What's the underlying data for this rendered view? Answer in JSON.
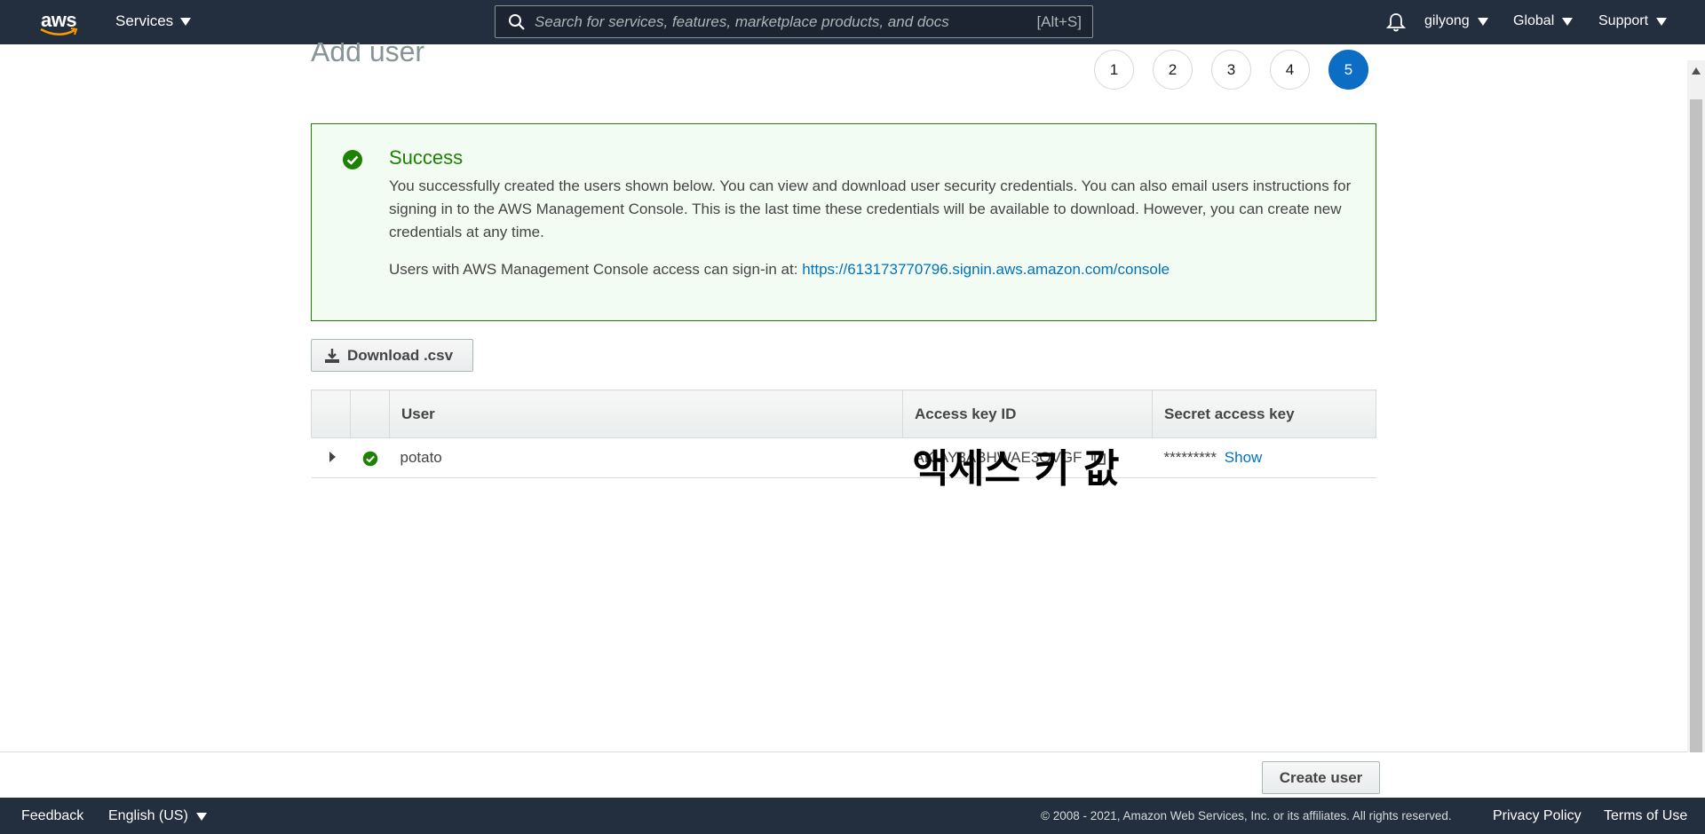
{
  "nav": {
    "logo_text": "aws",
    "services_label": "Services",
    "search_placeholder": "Search for services, features, marketplace products, and docs",
    "search_hint": "[Alt+S]",
    "user_label": "gilyong",
    "region_label": "Global",
    "support_label": "Support"
  },
  "page": {
    "title": "Add user",
    "steps": [
      "1",
      "2",
      "3",
      "4",
      "5"
    ],
    "active_step": "5"
  },
  "alert": {
    "title": "Success",
    "body": "You successfully created the users shown below. You can view and download user security credentials. You can also email users instructions for signing in to the AWS Management Console. This is the last time these credentials will be available to download. However, you can create new credentials at any time.",
    "signin_prefix": "Users with AWS Management Console access can sign-in at: ",
    "signin_url": "https://613173770796.signin.aws.amazon.com/console"
  },
  "download_label": "Download .csv",
  "table": {
    "headers": {
      "user": "User",
      "access_key": "Access key ID",
      "secret_key": "Secret access key"
    },
    "rows": [
      {
        "user": "potato",
        "access_key": "AKIAY3ABHWAE3OVGF",
        "overlay": "액세스 키 값",
        "secret_mask": "*********",
        "show_label": "Show"
      }
    ]
  },
  "create_user_label": "Create user",
  "footer": {
    "feedback": "Feedback",
    "language": "English (US)",
    "copyright": "© 2008 - 2021, Amazon Web Services, Inc. or its affiliates. All rights reserved.",
    "privacy": "Privacy Policy",
    "terms": "Terms of Use"
  },
  "colors": {
    "nav_bg": "#232f3e",
    "success": "#1d8102",
    "link": "#0073bb",
    "active_step": "#0b6dc4"
  }
}
